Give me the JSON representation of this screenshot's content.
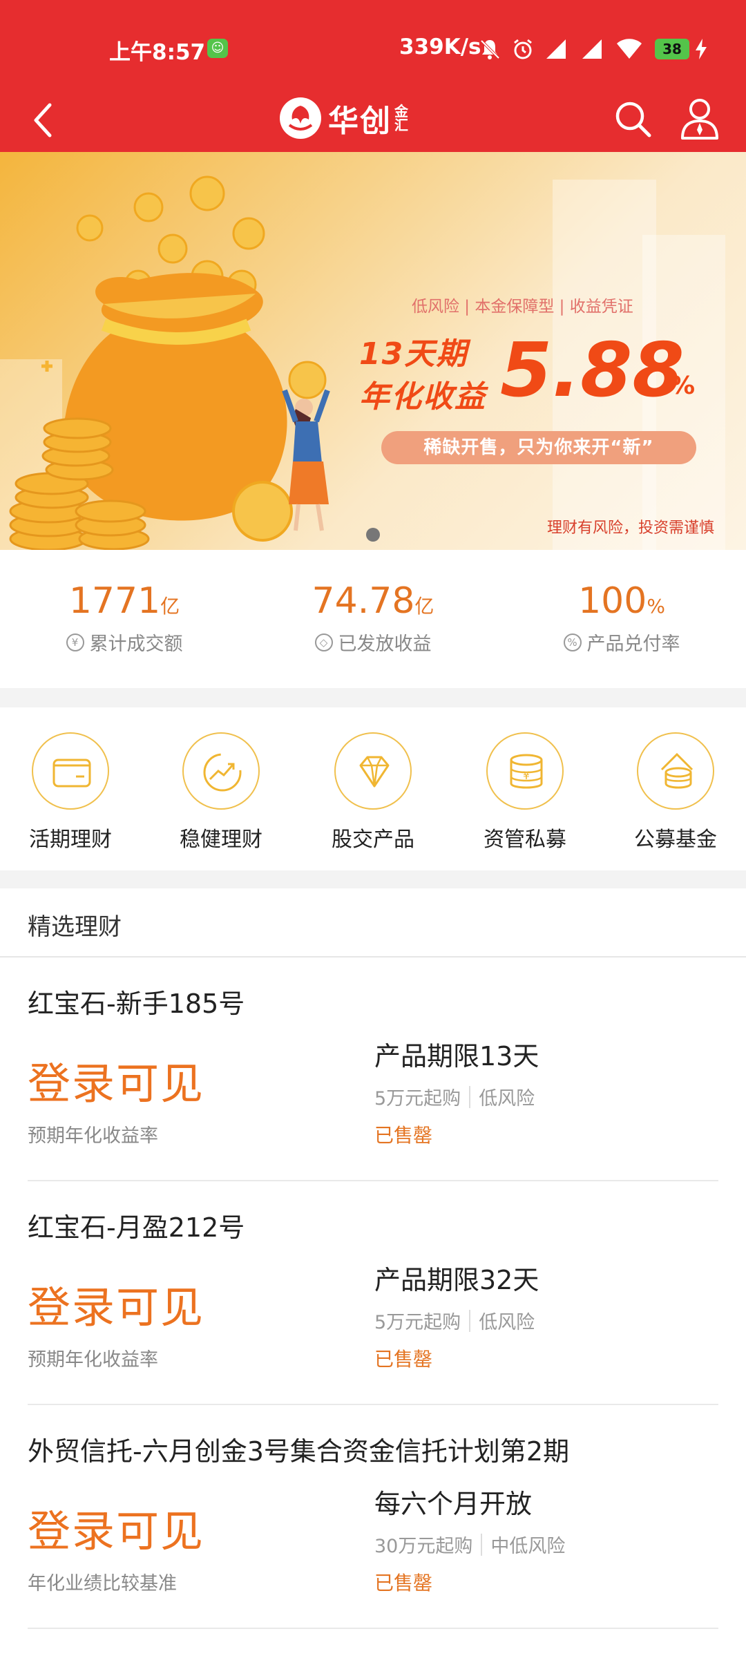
{
  "status_bar": {
    "time": "上午8:57",
    "network_speed": "339K/s",
    "battery": "38",
    "icons": [
      "wechat-notification-icon",
      "mute-bell-icon",
      "alarm-icon",
      "signal-icon",
      "signal-icon",
      "wifi-icon",
      "battery-icon",
      "charging-icon"
    ]
  },
  "header": {
    "logo_text": "华创",
    "logo_subtext": "金汇",
    "icons": [
      "back-arrow-icon",
      "search-icon",
      "user-icon"
    ]
  },
  "banner": {
    "tagline": "低风险 | 本金保障型 | 收益凭证",
    "headline_line1": "13天期",
    "headline_line2": "年化收益",
    "rate": "5.88",
    "rate_unit": "%",
    "pill_text": "稀缺开售，只为你来开“新”",
    "risk_notice": "理财有风险，投资需谨慎",
    "slides_total": 1,
    "slide_active": 1
  },
  "stats": [
    {
      "value": "1771",
      "unit": "亿",
      "label": "累计成交额",
      "icon": "¥"
    },
    {
      "value": "74.78",
      "unit": "亿",
      "label": "已发放收益",
      "icon": "◇"
    },
    {
      "value": "100",
      "unit": "%",
      "label": "产品兑付率",
      "icon": "%"
    }
  ],
  "categories": [
    {
      "label": "活期理财",
      "icon": "wallet-icon"
    },
    {
      "label": "稳健理财",
      "icon": "trend-up-icon"
    },
    {
      "label": "股交产品",
      "icon": "diamond-icon"
    },
    {
      "label": "资管私募",
      "icon": "coin-stack-icon"
    },
    {
      "label": "公募基金",
      "icon": "fund-coins-icon"
    }
  ],
  "section_title": "精选理财",
  "products": [
    {
      "name": "红宝石-新手185号",
      "rate_text": "登录可见",
      "rate_label": "预期年化收益率",
      "term": "产品期限13天",
      "min_invest": "5万元起购",
      "risk": "低风险",
      "status": "已售罄"
    },
    {
      "name": "红宝石-月盈212号",
      "rate_text": "登录可见",
      "rate_label": "预期年化收益率",
      "term": "产品期限32天",
      "min_invest": "5万元起购",
      "risk": "低风险",
      "status": "已售罄"
    },
    {
      "name": "外贸信托-六月创金3号集合资金信托计划第2期",
      "rate_text": "登录可见",
      "rate_label": "年化业绩比较基准",
      "term": "每六个月开放",
      "min_invest": "30万元起购",
      "risk": "中低风险",
      "status": "已售罄"
    }
  ],
  "colors": {
    "brand_red": "#e62d2f",
    "accent_orange": "#e47422",
    "icon_gold": "#f0c04d"
  }
}
